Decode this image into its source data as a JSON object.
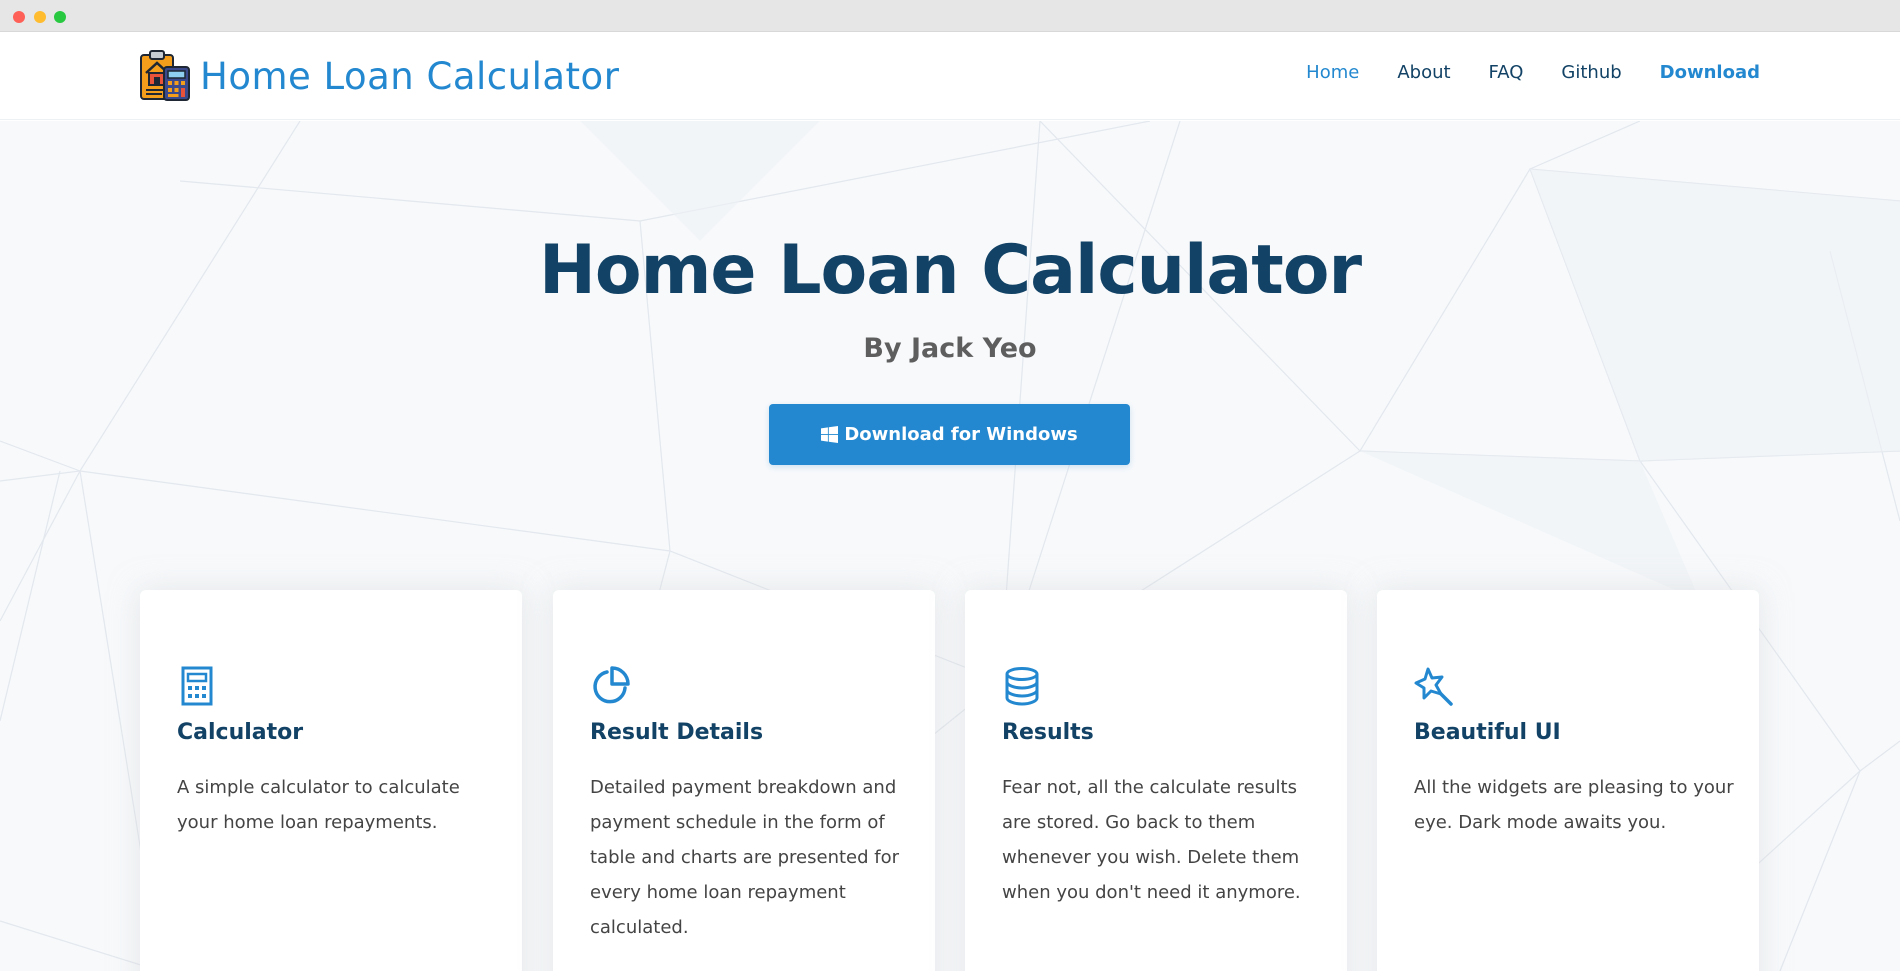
{
  "brand": {
    "name": "Home Loan Calculator",
    "logo_icon": "house-calculator-icon"
  },
  "nav": {
    "items": [
      {
        "label": "Home"
      },
      {
        "label": "About"
      },
      {
        "label": "FAQ"
      },
      {
        "label": "Github"
      },
      {
        "label": "Download"
      }
    ]
  },
  "hero": {
    "title": "Home Loan Calculator",
    "subtitle": "By Jack Yeo",
    "button_label": "Download for Windows",
    "button_icon": "windows-icon"
  },
  "features": [
    {
      "icon": "calculator-icon",
      "title": "Calculator",
      "text": "A simple calculator to calculate your home loan repayments."
    },
    {
      "icon": "pie-chart-icon",
      "title": "Result Details",
      "text": "Detailed payment breakdown and payment schedule in the form of table and charts are presented for every home loan repayment calculated."
    },
    {
      "icon": "database-icon",
      "title": "Results",
      "text": "Fear not, all the calculate results are stored. Go back to them whenever you wish. Delete them when you don't need it anymore."
    },
    {
      "icon": "magic-wand-icon",
      "title": "Beautiful UI",
      "text": "All the widgets are pleasing to your eye. Dark mode awaits you."
    }
  ],
  "colors": {
    "accent": "#2388cf",
    "heading": "#124265",
    "text": "#444444",
    "hero_bg": "#f7f9fb"
  }
}
